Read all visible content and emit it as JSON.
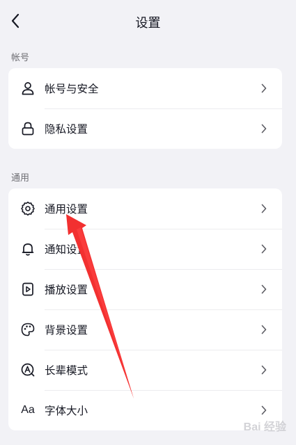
{
  "header": {
    "title": "设置",
    "back_icon": "chevron-left-icon"
  },
  "sections": [
    {
      "title": "帐号",
      "items": [
        {
          "label": "帐号与安全",
          "icon": "person-icon"
        },
        {
          "label": "隐私设置",
          "icon": "lock-icon"
        }
      ]
    },
    {
      "title": "通用",
      "items": [
        {
          "label": "通用设置",
          "icon": "gear-icon"
        },
        {
          "label": "通知设置",
          "icon": "bell-icon"
        },
        {
          "label": "播放设置",
          "icon": "play-icon"
        },
        {
          "label": "背景设置",
          "icon": "palette-icon"
        },
        {
          "label": "长辈模式",
          "icon": "elder-mode-icon"
        },
        {
          "label": "字体大小",
          "icon": "font-size-icon",
          "icon_text": "Aa"
        }
      ]
    }
  ],
  "annotation": {
    "arrow_color": "#f23030",
    "points_to": "通用设置"
  },
  "watermark": "Bai 经验"
}
